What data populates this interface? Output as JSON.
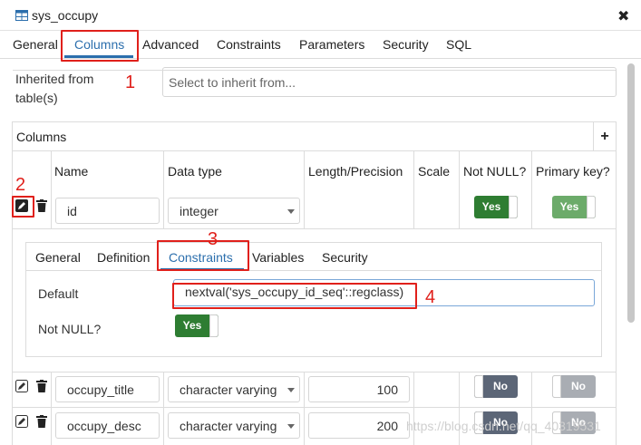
{
  "window": {
    "title": "sys_occupy",
    "close_glyph": "✖"
  },
  "tabs": [
    {
      "label": "General"
    },
    {
      "label": "Columns"
    },
    {
      "label": "Advanced"
    },
    {
      "label": "Constraints"
    },
    {
      "label": "Parameters"
    },
    {
      "label": "Security"
    },
    {
      "label": "SQL"
    }
  ],
  "inherit": {
    "label": "Inherited from table(s)",
    "placeholder": "Select to inherit from..."
  },
  "columns_section": {
    "title": "Columns",
    "add_glyph": "+"
  },
  "column_headers": [
    "Name",
    "Data type",
    "Length/Precision",
    "Scale",
    "Not NULL?",
    "Primary key?"
  ],
  "rows": [
    {
      "name": "id",
      "data_type": "integer",
      "length": "",
      "not_null": "Yes",
      "primary_key": "Yes"
    },
    {
      "name": "occupy_title",
      "data_type": "character varying",
      "length": "100",
      "not_null": "No",
      "primary_key": "No"
    },
    {
      "name": "occupy_desc",
      "data_type": "character varying",
      "length": "200",
      "not_null": "No",
      "primary_key": "No"
    }
  ],
  "subpanel": {
    "tabs": [
      {
        "label": "General"
      },
      {
        "label": "Definition"
      },
      {
        "label": "Constraints"
      },
      {
        "label": "Variables"
      },
      {
        "label": "Security"
      }
    ],
    "default_label": "Default",
    "default_value": "nextval('sys_occupy_id_seq'::regclass)",
    "not_null_label": "Not NULL?",
    "not_null_value": "Yes"
  },
  "annotations": [
    "1",
    "2",
    "3",
    "4"
  ],
  "watermark": "https://blog.csdn.net/qq_40319531",
  "colors": {
    "accent": "#2c6fad",
    "annotation": "#e0201b",
    "toggle_yes": "#2e7d32",
    "toggle_no": "#5c6677"
  }
}
